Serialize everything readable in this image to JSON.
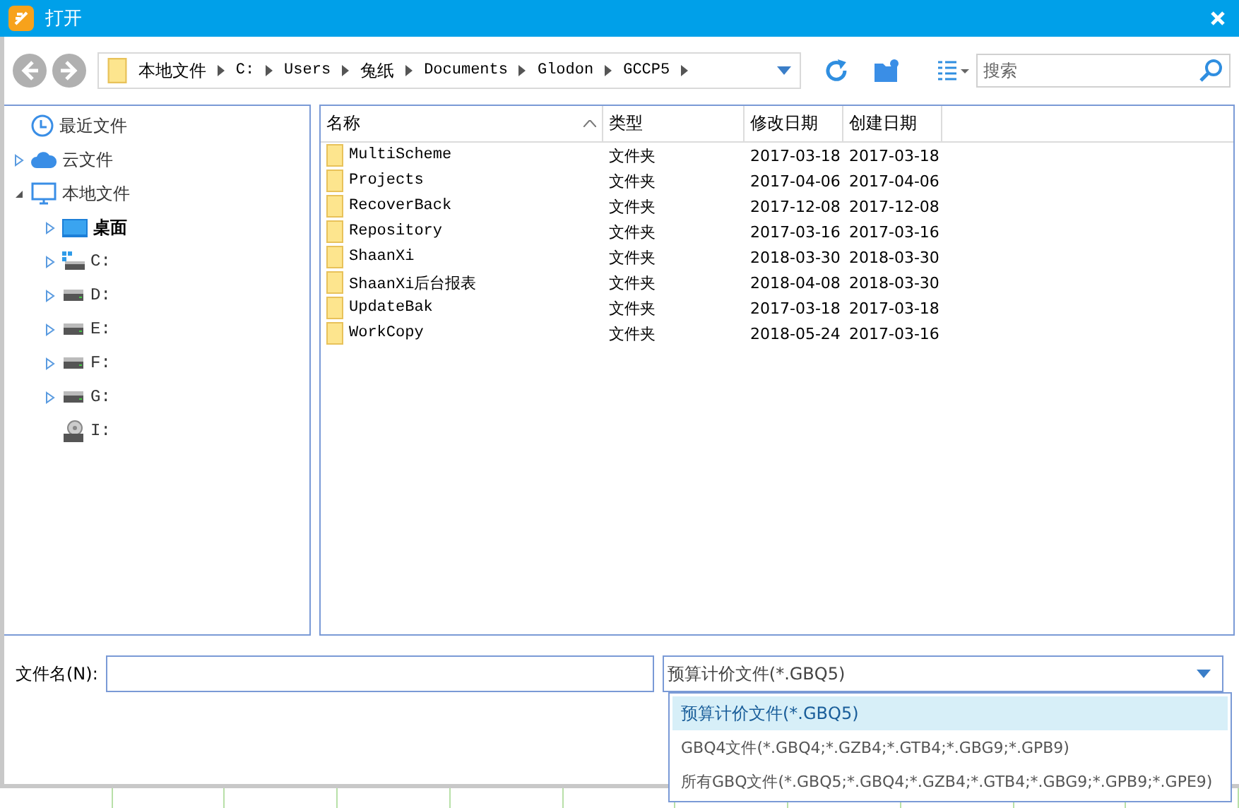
{
  "window": {
    "title": "打开"
  },
  "breadcrumb": [
    "本地文件",
    "C:",
    "Users",
    "兔纸",
    "Documents",
    "Glodon",
    "GCCP5"
  ],
  "search": {
    "placeholder": "搜索"
  },
  "tree": [
    {
      "label": "最近文件",
      "kind": "clock",
      "current": false
    },
    {
      "label": "云文件",
      "kind": "cloud",
      "expanded": false,
      "current": false
    },
    {
      "label": "本地文件",
      "kind": "monitor",
      "expanded": true,
      "current": false,
      "children": [
        {
          "label": "桌面",
          "kind": "desktop",
          "expanded": false,
          "current": true
        },
        {
          "label": "C:",
          "kind": "system-drive",
          "expanded": false,
          "current": false
        },
        {
          "label": "D:",
          "kind": "drive",
          "expanded": false,
          "current": false
        },
        {
          "label": "E:",
          "kind": "drive",
          "expanded": false,
          "current": false
        },
        {
          "label": "F:",
          "kind": "drive",
          "expanded": false,
          "current": false
        },
        {
          "label": "G:",
          "kind": "drive",
          "expanded": false,
          "current": false
        },
        {
          "label": "I:",
          "kind": "cd-drive",
          "current": false
        }
      ]
    }
  ],
  "table": {
    "columns": [
      "名称",
      "类型",
      "修改日期",
      "创建日期"
    ],
    "rows": [
      {
        "name": "MultiScheme",
        "type": "文件夹",
        "modified": "2017-03-18",
        "created": "2017-03-18"
      },
      {
        "name": "Projects",
        "type": "文件夹",
        "modified": "2017-04-06",
        "created": "2017-04-06"
      },
      {
        "name": "RecoverBack",
        "type": "文件夹",
        "modified": "2017-12-08",
        "created": "2017-12-08"
      },
      {
        "name": "Repository",
        "type": "文件夹",
        "modified": "2017-03-16",
        "created": "2017-03-16"
      },
      {
        "name": "ShaanXi",
        "type": "文件夹",
        "modified": "2018-03-30",
        "created": "2018-03-30"
      },
      {
        "name": "ShaanXi后台报表",
        "type": "文件夹",
        "modified": "2018-04-08",
        "created": "2018-03-30"
      },
      {
        "name": "UpdateBak",
        "type": "文件夹",
        "modified": "2017-03-18",
        "created": "2017-03-18"
      },
      {
        "name": "WorkCopy",
        "type": "文件夹",
        "modified": "2018-05-24",
        "created": "2017-03-16"
      }
    ]
  },
  "filename": {
    "label": "文件名(N):"
  },
  "filetype": {
    "value": "预算计价文件(*.GBQ5)",
    "options": [
      {
        "label": "预算计价文件(*.GBQ5)",
        "selected": true
      },
      {
        "label": "GBQ4文件(*.GBQ4;*.GZB4;*.GTB4;*.GBG9;*.GPB9)",
        "selected": false
      },
      {
        "label": "所有GBQ文件(*.GBQ5;*.GBQ4;*.GZB4;*.GTB4;*.GBG9;*.GPB9;*.GPE9)",
        "selected": false
      }
    ]
  }
}
